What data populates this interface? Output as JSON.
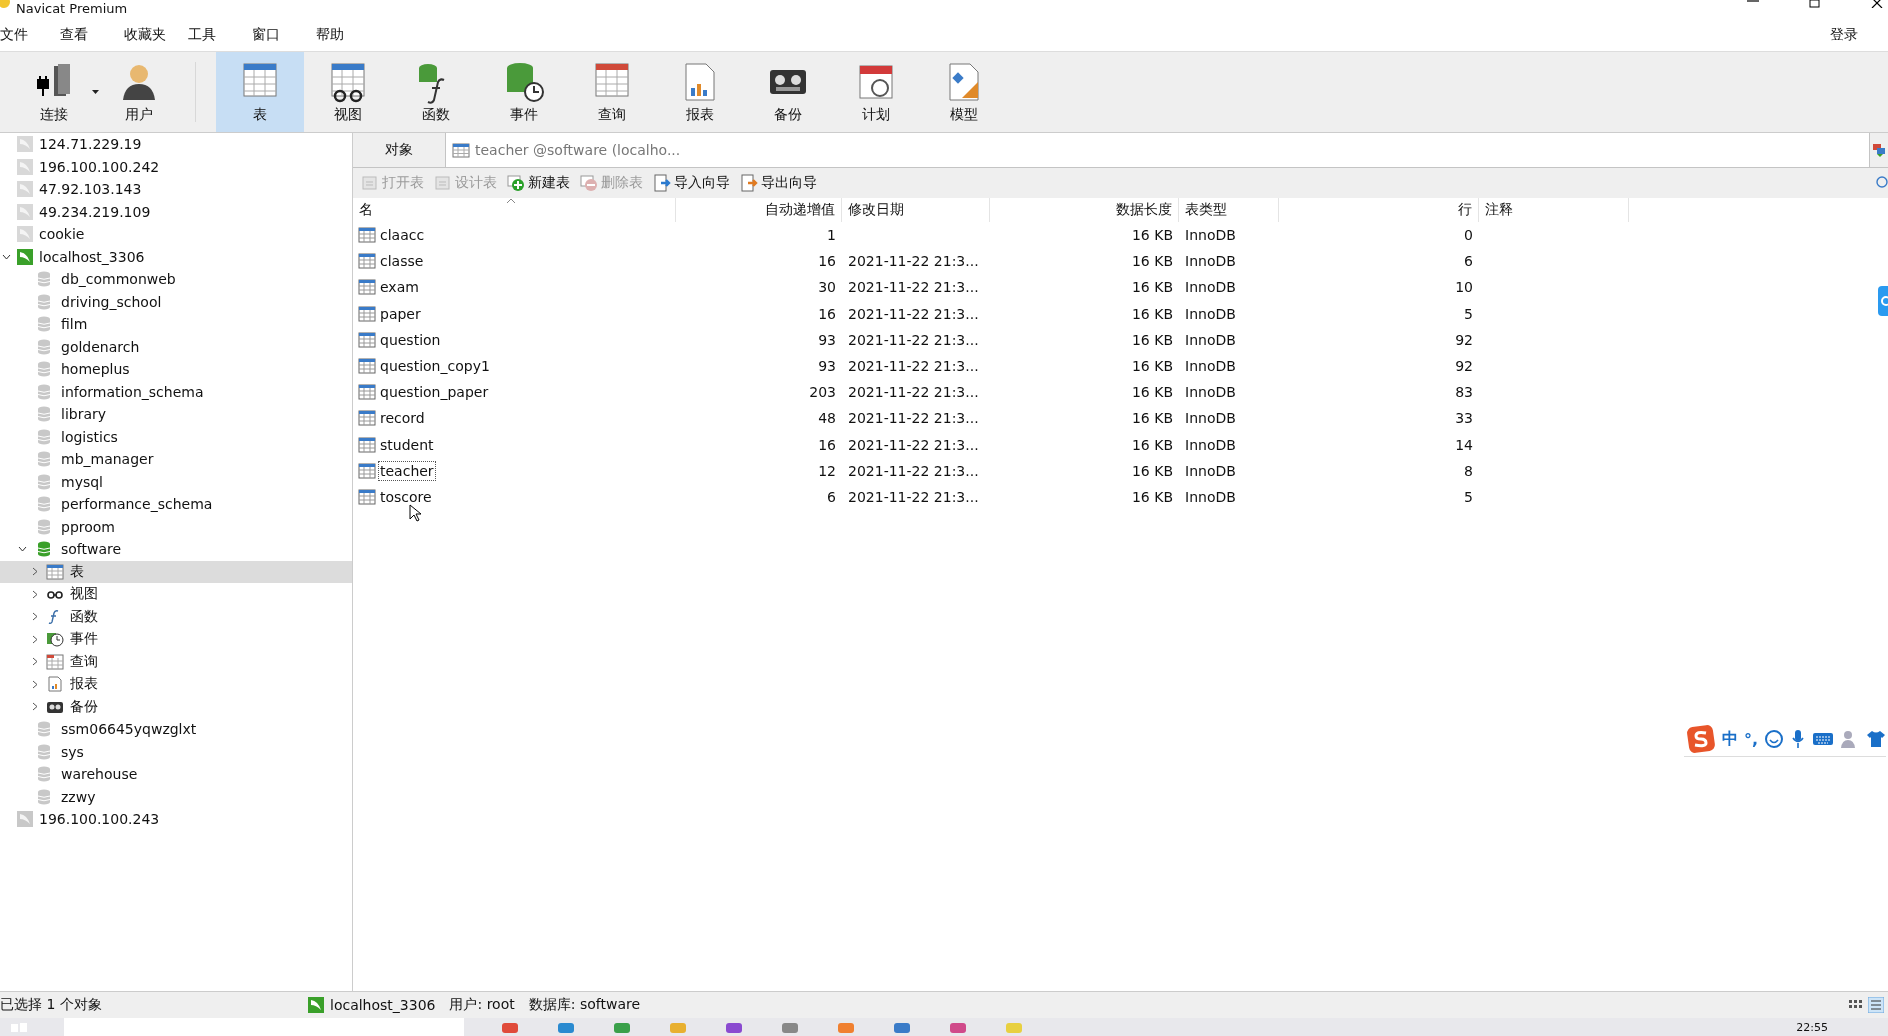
{
  "window": {
    "title": "Navicat Premium"
  },
  "menu": [
    "文件",
    "查看",
    "收藏夹",
    "工具",
    "窗口",
    "帮助"
  ],
  "login": "登录",
  "toolbar": [
    {
      "label": "连接",
      "kind": "connect",
      "selected": false
    },
    {
      "label": "用户",
      "kind": "user",
      "selected": false
    },
    {
      "label": "表",
      "kind": "table",
      "selected": true
    },
    {
      "label": "视图",
      "kind": "view",
      "selected": false
    },
    {
      "label": "函数",
      "kind": "function",
      "selected": false
    },
    {
      "label": "事件",
      "kind": "event",
      "selected": false
    },
    {
      "label": "查询",
      "kind": "query",
      "selected": false
    },
    {
      "label": "报表",
      "kind": "report",
      "selected": false
    },
    {
      "label": "备份",
      "kind": "backup",
      "selected": false
    },
    {
      "label": "计划",
      "kind": "schedule",
      "selected": false
    },
    {
      "label": "模型",
      "kind": "model",
      "selected": false
    }
  ],
  "sidebar": {
    "connections": [
      {
        "name": "124.71.229.19",
        "kind": "idle",
        "expanded": false
      },
      {
        "name": "196.100.100.242",
        "kind": "idle",
        "expanded": false
      },
      {
        "name": "47.92.103.143",
        "kind": "idle",
        "expanded": false
      },
      {
        "name": "49.234.219.109",
        "kind": "idle",
        "expanded": false
      },
      {
        "name": "cookie",
        "kind": "idle",
        "expanded": false
      },
      {
        "name": "localhost_3306",
        "kind": "open",
        "expanded": true,
        "children": [
          {
            "name": "db_commonweb",
            "open": false,
            "expanded": false
          },
          {
            "name": "driving_school",
            "open": false,
            "expanded": false
          },
          {
            "name": "film",
            "open": false,
            "expanded": false
          },
          {
            "name": "goldenarch",
            "open": false,
            "expanded": false
          },
          {
            "name": "homeplus",
            "open": false,
            "expanded": false
          },
          {
            "name": "information_schema",
            "open": false,
            "expanded": false
          },
          {
            "name": "library",
            "open": false,
            "expanded": false
          },
          {
            "name": "logistics",
            "open": false,
            "expanded": false
          },
          {
            "name": "mb_manager",
            "open": false,
            "expanded": false
          },
          {
            "name": "mysql",
            "open": false,
            "expanded": false
          },
          {
            "name": "performance_schema",
            "open": false,
            "expanded": false
          },
          {
            "name": "pproom",
            "open": false,
            "expanded": false
          },
          {
            "name": "software",
            "open": true,
            "expanded": true,
            "children": [
              {
                "name": "表",
                "kind": "table",
                "selected": true
              },
              {
                "name": "视图",
                "kind": "view",
                "selected": false
              },
              {
                "name": "函数",
                "kind": "function",
                "selected": false
              },
              {
                "name": "事件",
                "kind": "event",
                "selected": false
              },
              {
                "name": "查询",
                "kind": "query",
                "selected": false
              },
              {
                "name": "报表",
                "kind": "report",
                "selected": false
              },
              {
                "name": "备份",
                "kind": "backup",
                "selected": false
              }
            ]
          },
          {
            "name": "ssm06645yqwzglxt",
            "open": false,
            "expanded": false
          },
          {
            "name": "sys",
            "open": false,
            "expanded": false
          },
          {
            "name": "warehouse",
            "open": false,
            "expanded": false
          },
          {
            "name": "zzwy",
            "open": false,
            "expanded": false
          }
        ]
      },
      {
        "name": "196.100.100.243",
        "kind": "other",
        "expanded": false
      }
    ]
  },
  "object_bar": {
    "label": "对象",
    "tab": "teacher @software (localho..."
  },
  "actions": [
    {
      "label": "打开表",
      "kind": "open",
      "disabled": true
    },
    {
      "label": "设计表",
      "kind": "design",
      "disabled": true
    },
    {
      "label": "新建表",
      "kind": "new",
      "disabled": false
    },
    {
      "label": "删除表",
      "kind": "delete",
      "disabled": true
    },
    {
      "label": "导入向导",
      "kind": "import",
      "disabled": false
    },
    {
      "label": "导出向导",
      "kind": "export",
      "disabled": false
    }
  ],
  "table": {
    "columns": [
      "名",
      "自动递增值",
      "修改日期",
      "数据长度",
      "表类型",
      "行",
      "注释"
    ],
    "rows": [
      {
        "name": "claacc",
        "auto_increment": "1",
        "modified": "",
        "size": "16 KB",
        "type": "InnoDB",
        "rows": "0",
        "focused": false
      },
      {
        "name": "classe",
        "auto_increment": "16",
        "modified": "2021-11-22 21:3...",
        "size": "16 KB",
        "type": "InnoDB",
        "rows": "6",
        "focused": false
      },
      {
        "name": "exam",
        "auto_increment": "30",
        "modified": "2021-11-22 21:3...",
        "size": "16 KB",
        "type": "InnoDB",
        "rows": "10",
        "focused": false
      },
      {
        "name": "paper",
        "auto_increment": "16",
        "modified": "2021-11-22 21:3...",
        "size": "16 KB",
        "type": "InnoDB",
        "rows": "5",
        "focused": false
      },
      {
        "name": "question",
        "auto_increment": "93",
        "modified": "2021-11-22 21:3...",
        "size": "16 KB",
        "type": "InnoDB",
        "rows": "92",
        "focused": false
      },
      {
        "name": "question_copy1",
        "auto_increment": "93",
        "modified": "2021-11-22 21:3...",
        "size": "16 KB",
        "type": "InnoDB",
        "rows": "92",
        "focused": false
      },
      {
        "name": "question_paper",
        "auto_increment": "203",
        "modified": "2021-11-22 21:3...",
        "size": "16 KB",
        "type": "InnoDB",
        "rows": "83",
        "focused": false
      },
      {
        "name": "record",
        "auto_increment": "48",
        "modified": "2021-11-22 21:3...",
        "size": "16 KB",
        "type": "InnoDB",
        "rows": "33",
        "focused": false
      },
      {
        "name": "student",
        "auto_increment": "16",
        "modified": "2021-11-22 21:3...",
        "size": "16 KB",
        "type": "InnoDB",
        "rows": "14",
        "focused": false
      },
      {
        "name": "teacher",
        "auto_increment": "12",
        "modified": "2021-11-22 21:3...",
        "size": "16 KB",
        "type": "InnoDB",
        "rows": "8",
        "focused": true
      },
      {
        "name": "toscore",
        "auto_increment": "6",
        "modified": "2021-11-22 21:3...",
        "size": "16 KB",
        "type": "InnoDB",
        "rows": "5",
        "focused": false
      }
    ]
  },
  "ime": {
    "mode": "中",
    "punct": "°,"
  },
  "status_bar": {
    "selection": "已选择 1 个对象",
    "connection": "localhost_3306",
    "user": "用户: root",
    "database": "数据库: software"
  },
  "taskbar": {
    "time": "22:55"
  }
}
